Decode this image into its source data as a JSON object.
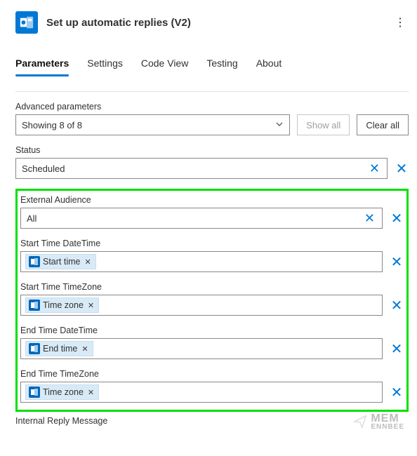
{
  "header": {
    "title": "Set up automatic replies (V2)"
  },
  "tabs": [
    "Parameters",
    "Settings",
    "Code View",
    "Testing",
    "About"
  ],
  "activeTab": 0,
  "advanced": {
    "label": "Advanced parameters",
    "selectValue": "Showing 8 of 8",
    "showAll": "Show all",
    "clearAll": "Clear all"
  },
  "fields": {
    "status": {
      "label": "Status",
      "value": "Scheduled"
    },
    "externalAudience": {
      "label": "External Audience",
      "value": "All"
    },
    "startDateTime": {
      "label": "Start Time DateTime",
      "token": "Start time"
    },
    "startTimeZone": {
      "label": "Start Time TimeZone",
      "token": "Time zone"
    },
    "endDateTime": {
      "label": "End Time DateTime",
      "token": "End time"
    },
    "endTimeZone": {
      "label": "End Time TimeZone",
      "token": "Time zone"
    },
    "internalReply": {
      "label": "Internal Reply Message"
    }
  },
  "watermark": {
    "top": "MEM",
    "bottom": "ENNBEE"
  }
}
